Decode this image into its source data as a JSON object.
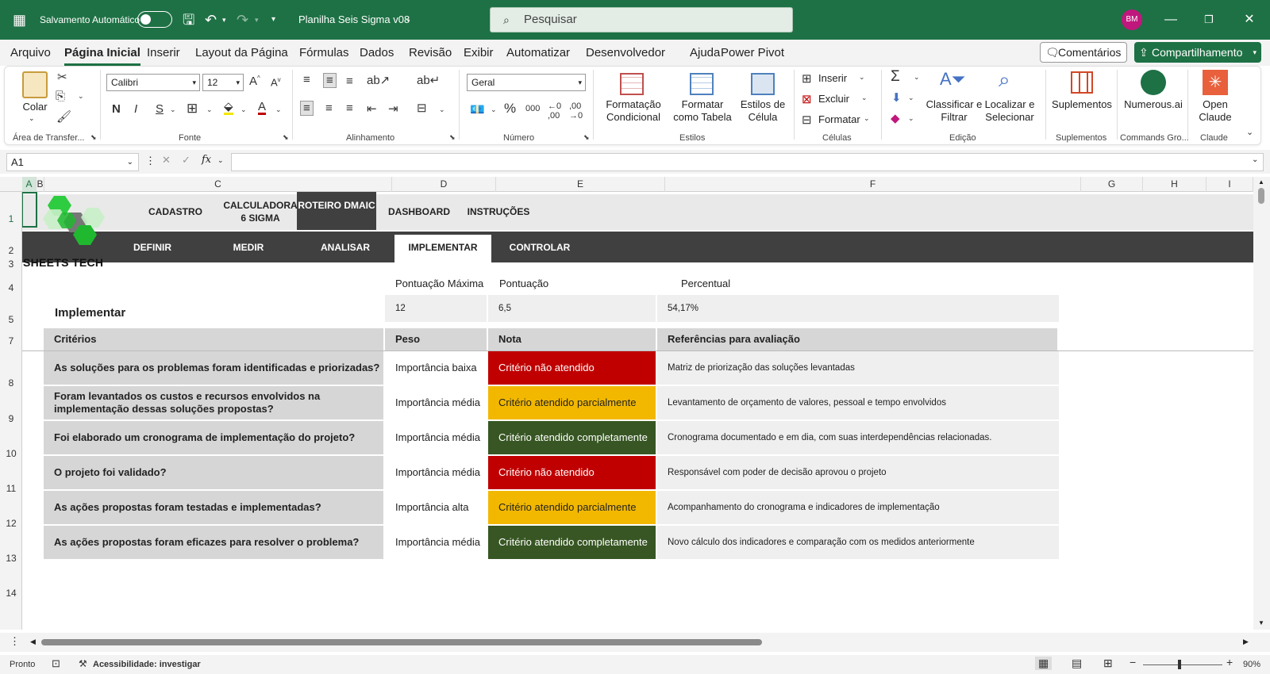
{
  "titlebar": {
    "autosave_label": "Salvamento Automático",
    "doc_title": "Planilha Seis Sigma v08",
    "search_placeholder": "Pesquisar",
    "avatar_initials": "BM"
  },
  "menu": [
    "Arquivo",
    "Página Inicial",
    "Inserir",
    "Layout da Página",
    "Fórmulas",
    "Dados",
    "Revisão",
    "Exibir",
    "Automatizar",
    "Desenvolvedor",
    "Ajuda",
    "Power Pivot"
  ],
  "menu_active": "Página Inicial",
  "comments_label": "Comentários",
  "share_label": "Compartilhamento",
  "ribbon": {
    "paste": "Colar",
    "font_name": "Calibri",
    "font_size": "12",
    "number_format": "Geral",
    "cond_format": "Formatação Condicional",
    "format_table": "Formatar como Tabela",
    "cell_styles": "Estilos de Célula",
    "insert": "Inserir",
    "delete": "Excluir",
    "format": "Formatar",
    "sort_filter": "Classificar e Filtrar",
    "find_select": "Localizar e Selecionar",
    "addins": "Suplementos",
    "numerous": "Numerous.ai",
    "open_claude": "Open Claude",
    "groups": {
      "clipboard": "Área de Transfer...",
      "font": "Fonte",
      "alignment": "Alinhamento",
      "number": "Número",
      "styles": "Estilos",
      "cells": "Células",
      "editing": "Edição",
      "addins": "Suplementos",
      "commands": "Commands Gro...",
      "claude": "Claude"
    }
  },
  "namebox": "A1",
  "columns": [
    "A",
    "B",
    "C",
    "D",
    "E",
    "F",
    "G",
    "H",
    "I"
  ],
  "rows": [
    "1",
    "2",
    "3",
    "4",
    "5",
    "7",
    "8",
    "9",
    "10",
    "11",
    "12",
    "13",
    "14"
  ],
  "sheet": {
    "logo_text": "SHEETS TECH",
    "nav1": [
      "CADASTRO",
      "CALCULADORA 6 SIGMA",
      "ROTEIRO DMAIC",
      "DASHBOARD",
      "INSTRUÇÕES"
    ],
    "nav1_selected": "ROTEIRO DMAIC",
    "nav2": [
      "DEFINIR",
      "MEDIR",
      "ANALISAR",
      "IMPLEMENTAR",
      "CONTROLAR"
    ],
    "nav2_selected": "IMPLEMENTAR",
    "section_title": "Implementar",
    "score_headers": {
      "max": "Pontuação Máxima",
      "score": "Pontuação",
      "percent": "Percentual"
    },
    "score_values": {
      "max": "12",
      "score": "6,5",
      "percent": "54,17%"
    },
    "table_headers": {
      "criteria": "Critérios",
      "weight": "Peso",
      "grade": "Nota",
      "refs": "Referências para avaliação"
    },
    "rows": [
      {
        "criterion": "As soluções para os problemas foram identificadas e priorizadas?",
        "weight": "Importância baixa",
        "grade": "Critério não atendido",
        "status": "red",
        "ref": "Matriz de priorização das soluções levantadas"
      },
      {
        "criterion": "Foram levantados os custos e recursos envolvidos na implementação dessas soluções propostas?",
        "weight": "Importância média",
        "grade": "Critério atendido parcialmente",
        "status": "yellow",
        "ref": "Levantamento de orçamento de valores, pessoal e tempo envolvidos"
      },
      {
        "criterion": "Foi elaborado um cronograma de implementação do projeto?",
        "weight": "Importância média",
        "grade": "Critério atendido completamente",
        "status": "green",
        "ref": "Cronograma documentado e em dia, com suas interdependências relacionadas."
      },
      {
        "criterion": "O projeto foi validado?",
        "weight": "Importância média",
        "grade": "Critério não atendido",
        "status": "red",
        "ref": "Responsável com poder de decisão aprovou o projeto"
      },
      {
        "criterion": "As ações propostas foram testadas e implementadas?",
        "weight": "Importância alta",
        "grade": "Critério atendido parcialmente",
        "status": "yellow",
        "ref": "Acompanhamento do cronograma e indicadores de implementação"
      },
      {
        "criterion": "As ações propostas foram eficazes para resolver o problema?",
        "weight": "Importância média",
        "grade": "Critério atendido completamente",
        "status": "green",
        "ref": "Novo cálculo dos indicadores e comparação com os medidos anteriormente"
      }
    ]
  },
  "status": {
    "ready": "Pronto",
    "accessibility": "Acessibilidade: investigar",
    "zoom": "90%"
  },
  "colors": {
    "excel_green": "#1e7145",
    "red": "#c00000",
    "yellow": "#f2b800",
    "dark_green": "#375623",
    "nav_dark": "#404040"
  }
}
